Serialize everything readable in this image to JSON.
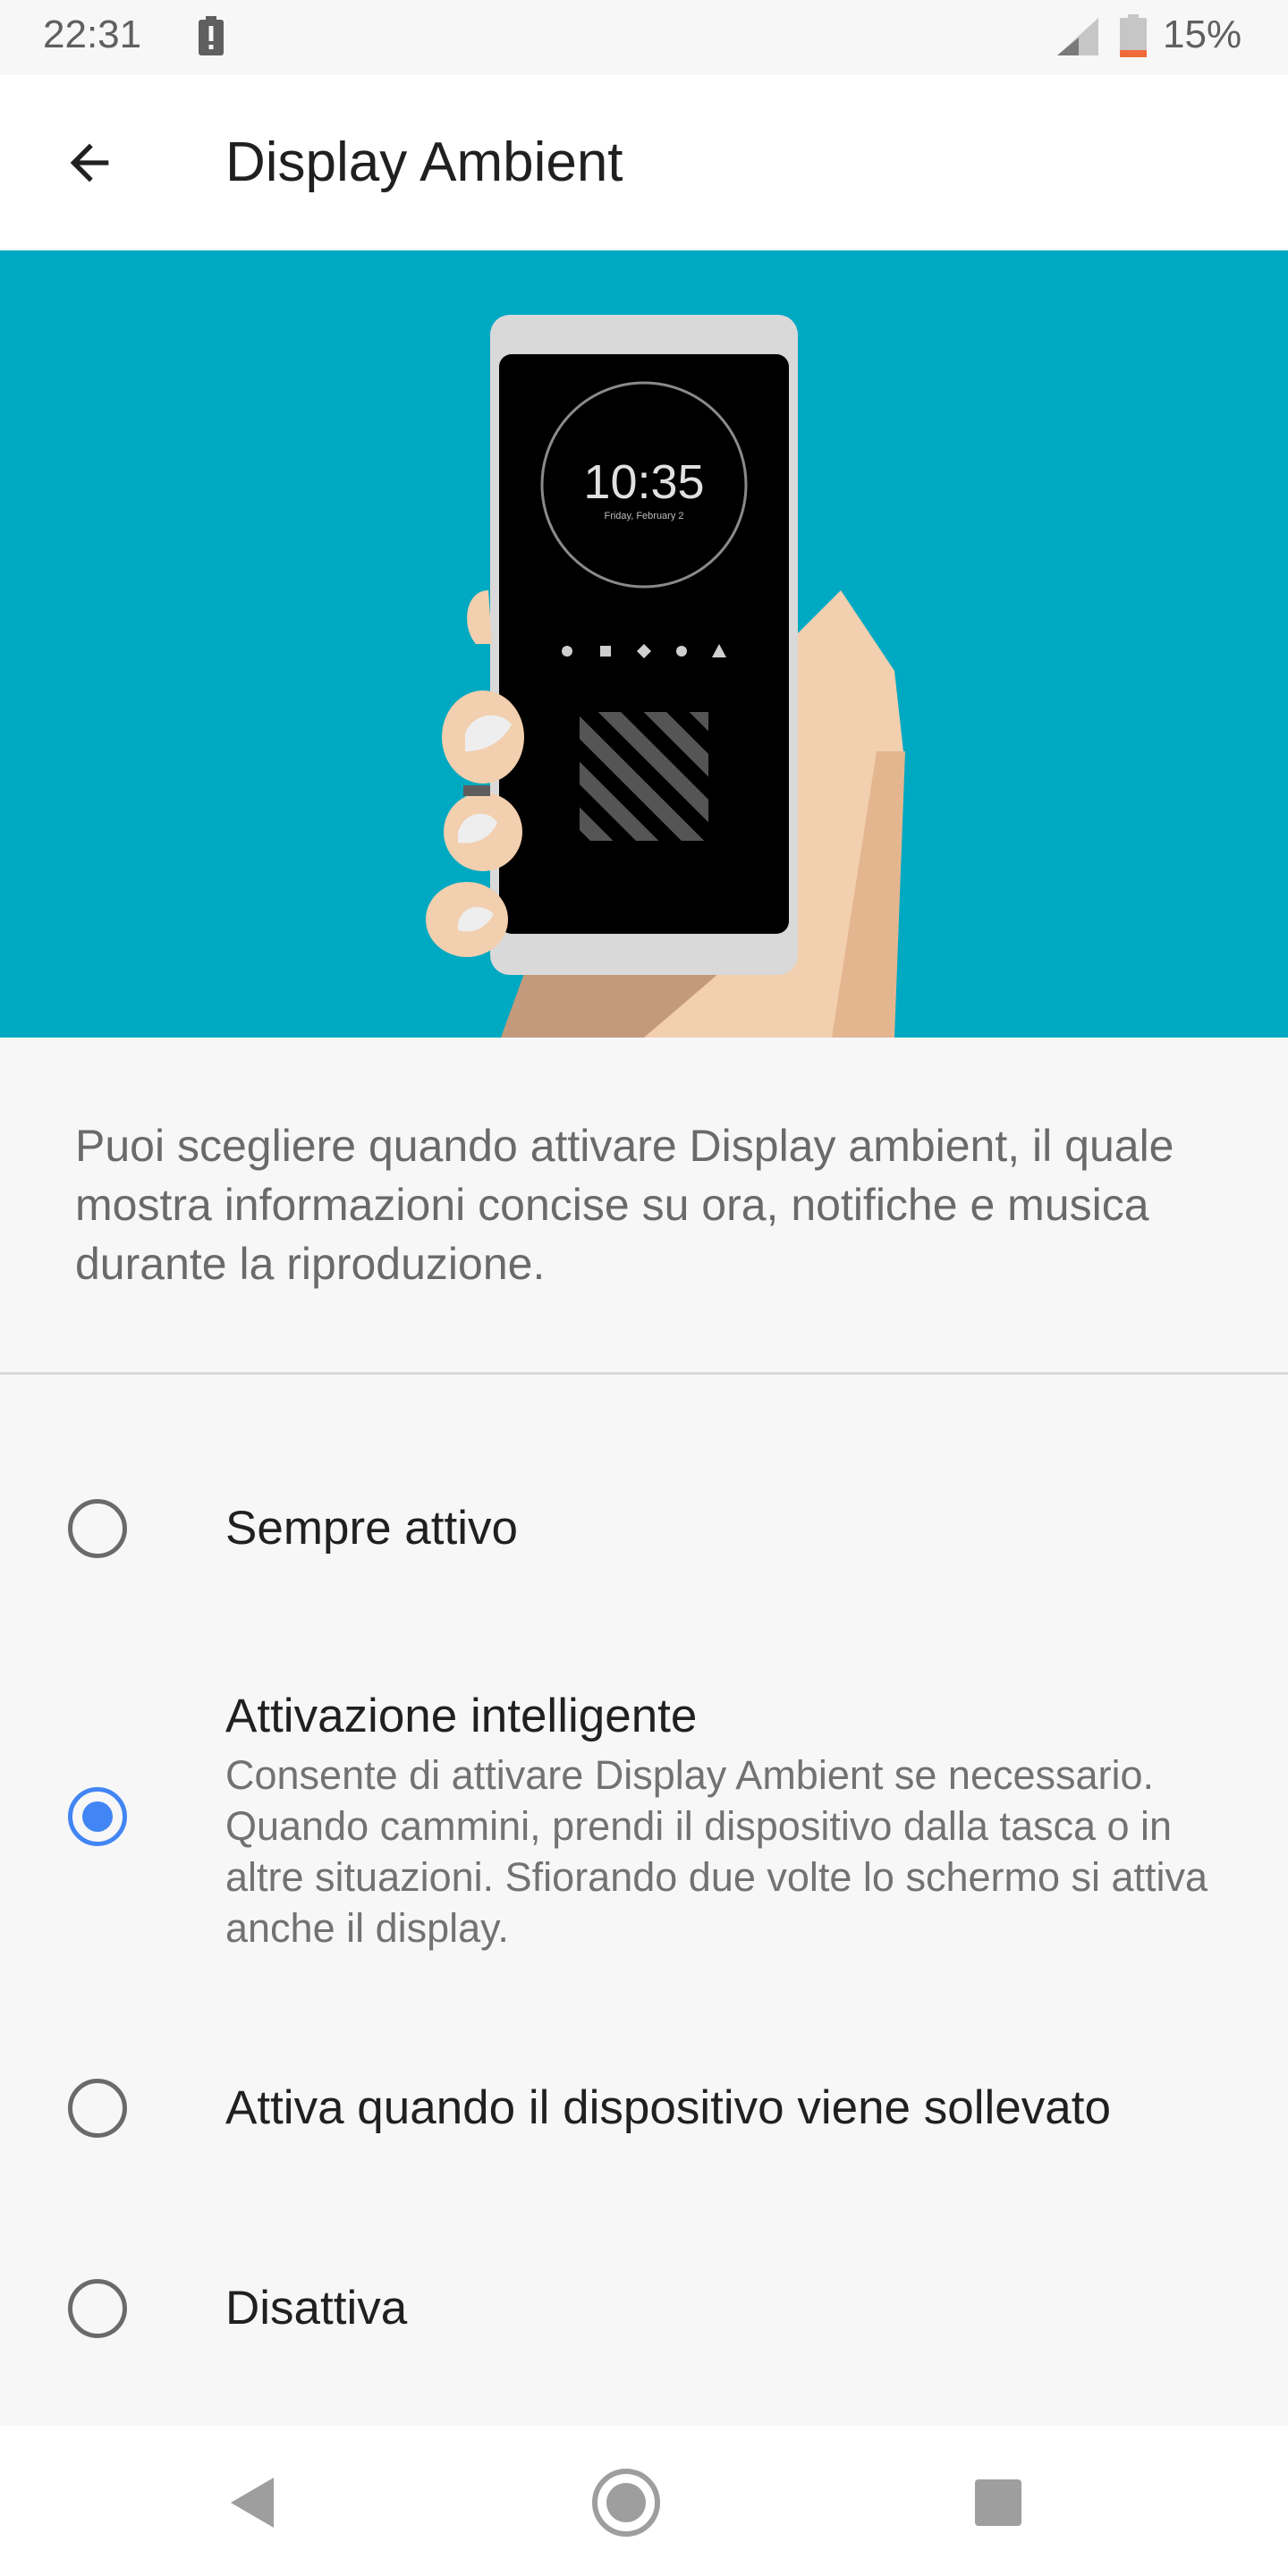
{
  "status_bar": {
    "time": "22:31",
    "battery_percent": "15%",
    "alert_icon": "battery-alert-icon",
    "signal_icon": "cell-signal-icon",
    "battery_icon": "battery-low-icon"
  },
  "app_bar": {
    "back_icon": "arrow-back-icon",
    "title": "Display Ambient"
  },
  "hero": {
    "clock_time": "10:35",
    "clock_date": "Friday, February 2",
    "background_color": "#00a9c2"
  },
  "description": "Puoi scegliere quando attivare Display ambient, il quale mostra informazioni concise su ora, notifiche e musica durante la riproduzione.",
  "options": [
    {
      "label": "Sempre attivo",
      "selected": false
    },
    {
      "label": "Attivazione intelligente",
      "summary": "Consente di attivare Display Ambient se necessario. Quando cammini, prendi il dispositivo dalla tasca o in altre situazioni. Sfiorando due volte lo schermo si attiva anche il display.",
      "selected": true
    },
    {
      "label": "Attiva quando il dispositivo viene sollevato",
      "selected": false
    },
    {
      "label": "Disattiva",
      "selected": false
    }
  ],
  "nav_bar": {
    "back_icon": "nav-back-icon",
    "home_icon": "nav-home-icon",
    "recents_icon": "nav-recents-icon"
  },
  "colors": {
    "accent": "#4285f4",
    "battery_low": "#ef6c3a"
  }
}
